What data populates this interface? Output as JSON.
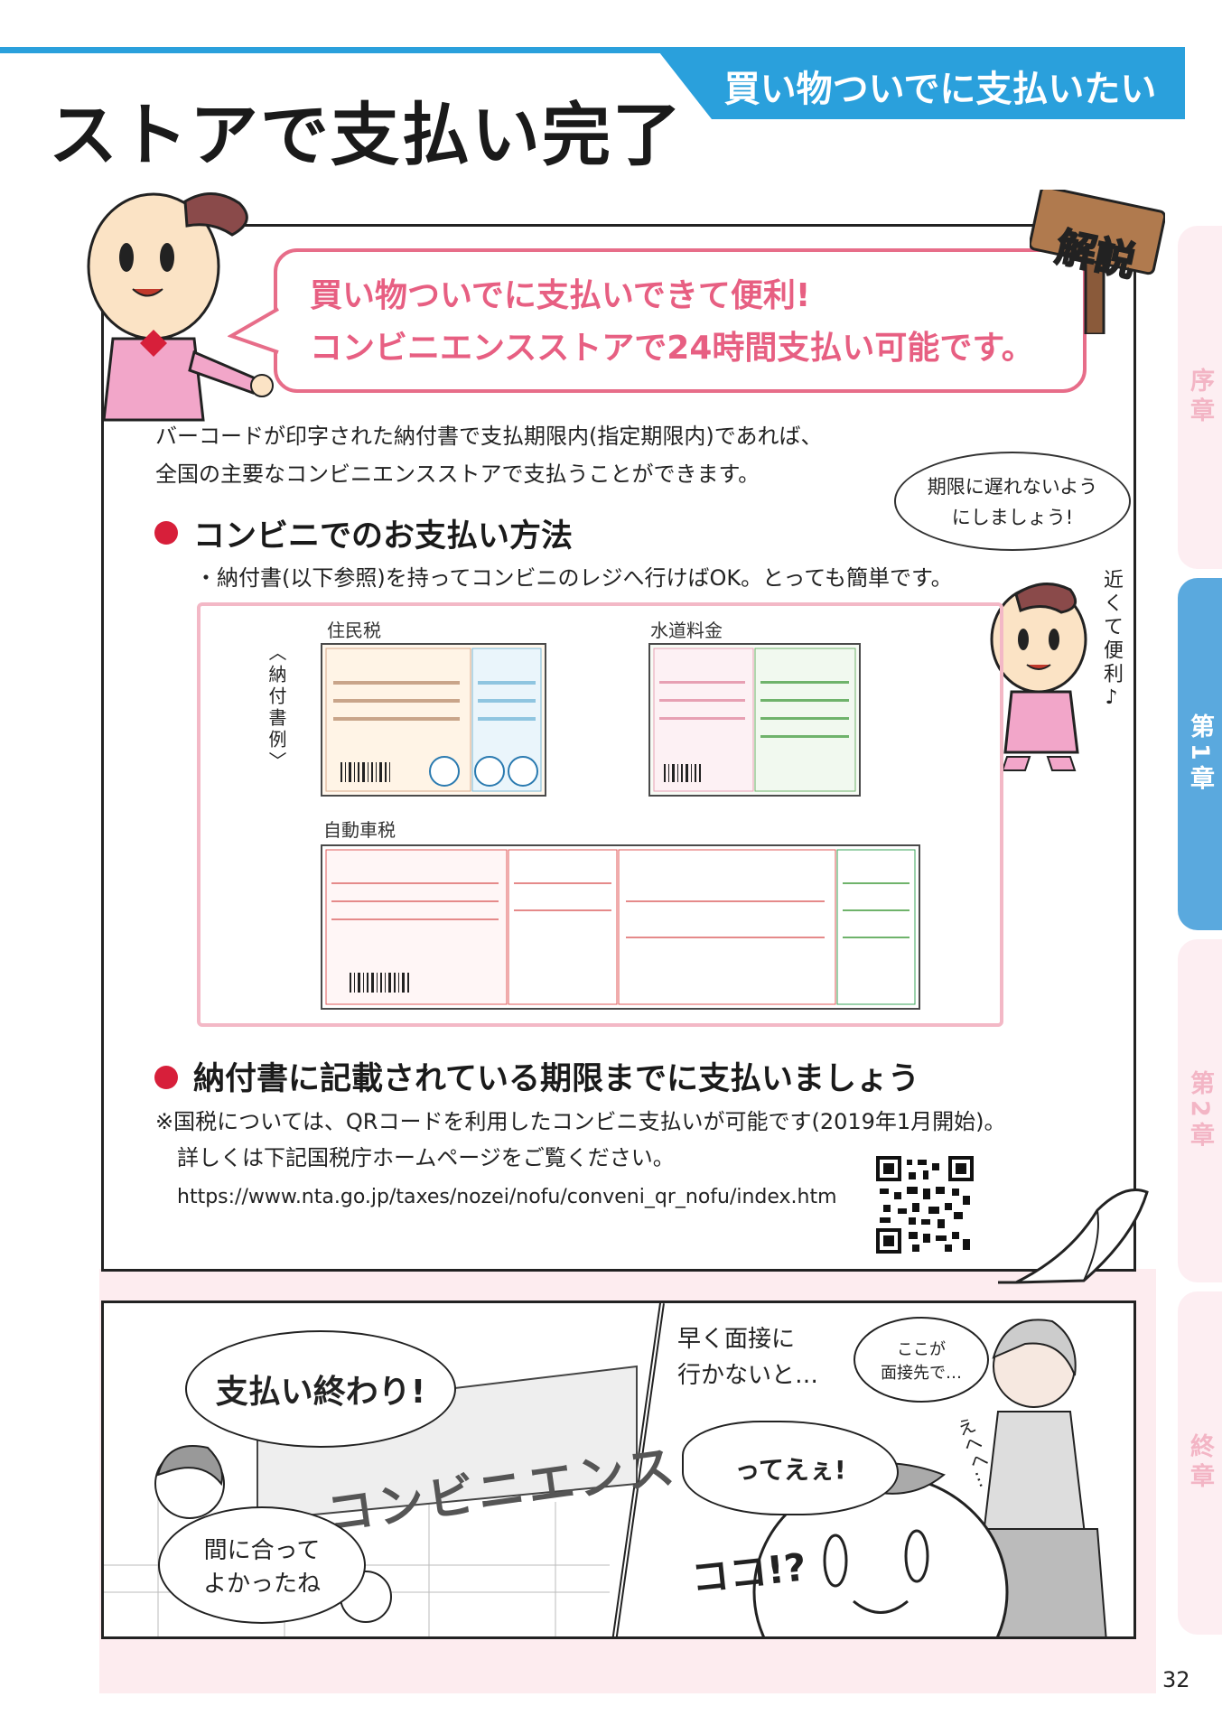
{
  "header": {
    "topic_tab": "買い物ついでに支払いたい",
    "title": "ストアで支払い完了"
  },
  "side_tabs": [
    {
      "label": "序章",
      "active": false
    },
    {
      "label": "第1章",
      "active": true
    },
    {
      "label": "第2章",
      "active": false
    },
    {
      "label": "終章",
      "active": false
    }
  ],
  "explanation": {
    "sign": "解説",
    "speech_line1": "買い物ついでに支払いできて便利!",
    "speech_line2": "コンビニエンスストアで24時間支払い可能です。",
    "intro_line1": "バーコードが印字された納付書で支払期限内(指定期限内)であれば、",
    "intro_line2": "全国の主要なコンビニエンスストアで支払うことができます。",
    "thought_line1": "期限に遅れないよう",
    "thought_line2": "にしましょう!",
    "side_note": "近くて便利♪",
    "section1_heading": "コンビニでのお支払い方法",
    "section1_text": "・納付書(以下参照)を持ってコンビニのレジへ行けばOK。とっても簡単です。",
    "forms_vertical_label": "〈納付書例〉",
    "form_labels": {
      "resident": "住民税",
      "water": "水道料金",
      "car": "自動車税"
    },
    "section2_heading": "納付書に記載されている期限までに支払いましょう",
    "note_line1": "※国税については、QRコードを利用したコンビニ支払いが可能です(2019年1月開始)。",
    "note_line2": "詳しくは下記国税庁ホームページをご覧ください。",
    "url": "https://www.nta.go.jp/taxes/nozei/nofu/conveni_qr_nofu/index.htm"
  },
  "manga": {
    "bubble_paid": "支払い終わり!",
    "sign_text": "コンビニエンス",
    "bubble_ontime_1": "間に合って",
    "bubble_ontime_2": "よかったね",
    "narration_1": "早く面接に",
    "narration_2": "行かないと…",
    "bubble_here_1": "ここが",
    "bubble_here_2": "面接先で…",
    "sfx_ehehe": "えへへ…",
    "bubble_tee": "ってえぇ!",
    "sfx_koko": "ココ!?"
  },
  "page_number": "32",
  "colors": {
    "blue": "#2aa0dc",
    "pink": "#e75f82",
    "red_dot": "#d71f3a",
    "side_active": "#5aa9de"
  }
}
